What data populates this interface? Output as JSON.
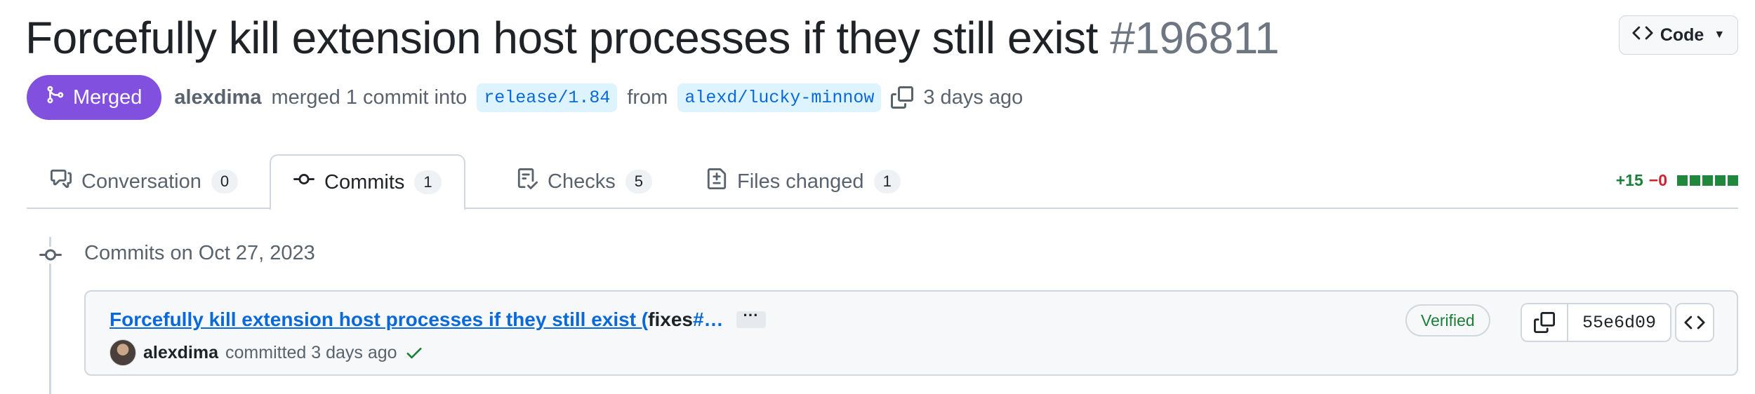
{
  "pr": {
    "title": "Forcefully kill extension host processes if they still exist",
    "number": "#196811",
    "state": "Merged",
    "author": "alexdima",
    "merge_text": "merged 1 commit into",
    "base_branch": "release/1.84",
    "from_text": "from",
    "head_branch": "alexd/lucky-minnow",
    "time_ago": "3 days ago"
  },
  "code_button": {
    "label": "Code"
  },
  "tabs": [
    {
      "label": "Conversation",
      "count": "0",
      "icon": "comment-discussion-icon"
    },
    {
      "label": "Commits",
      "count": "1",
      "icon": "git-commit-icon",
      "active": true
    },
    {
      "label": "Checks",
      "count": "5",
      "icon": "checklist-icon"
    },
    {
      "label": "Files changed",
      "count": "1",
      "icon": "file-diff-icon"
    }
  ],
  "diffstat": {
    "additions": "+15",
    "deletions": "−0",
    "blocks": 5
  },
  "commits_section": {
    "date_heading": "Commits on Oct 27, 2023",
    "commits": [
      {
        "message_link": "Forcefully kill extension host processes if they still exist (",
        "message_plain": "fixes",
        "message_tail": " #…",
        "more_label": "···",
        "author": "alexdima",
        "committed_text": "committed 3 days ago",
        "verified_label": "Verified",
        "sha": "55e6d09"
      }
    ]
  },
  "colors": {
    "merged": "#8250df",
    "link": "#0969da",
    "addition": "#1a7f37",
    "deletion": "#cf222e"
  }
}
